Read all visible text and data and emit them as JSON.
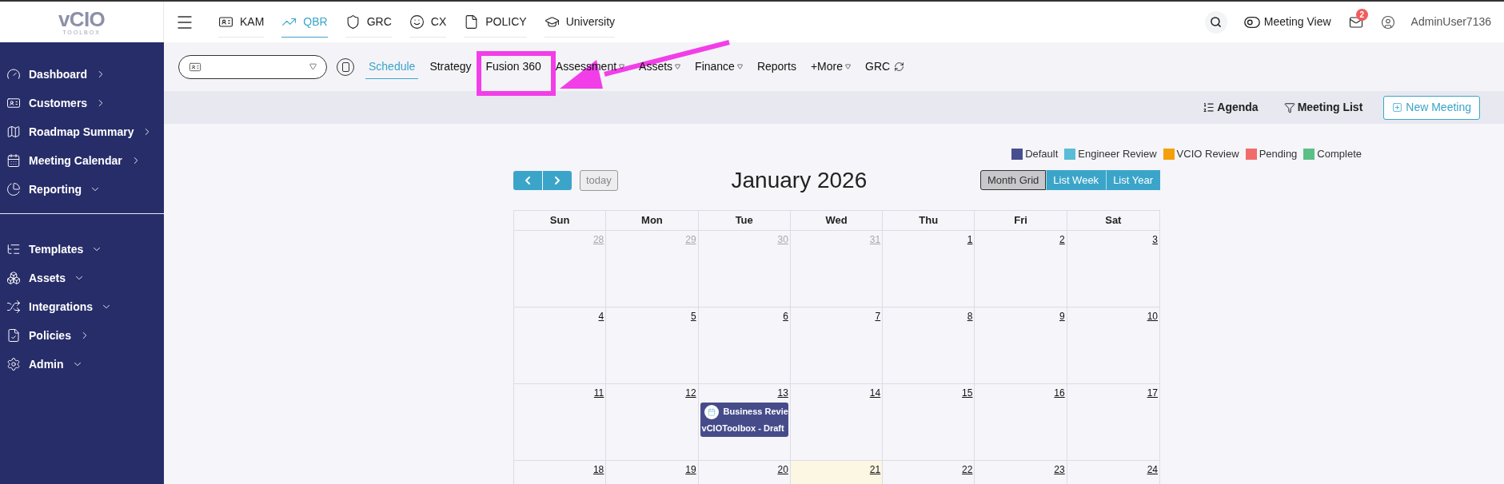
{
  "logo": {
    "text": "vCIO",
    "subtext": "TOOLBOX"
  },
  "sidebar": {
    "groups": [
      [
        {
          "label": "Dashboard",
          "expanded": false
        },
        {
          "label": "Customers",
          "expanded": false
        },
        {
          "label": "Roadmap Summary",
          "expanded": false
        },
        {
          "label": "Meeting Calendar",
          "expanded": false
        },
        {
          "label": "Reporting",
          "expanded": true
        }
      ],
      [
        {
          "label": "Templates",
          "expanded": true
        },
        {
          "label": "Assets",
          "expanded": true
        },
        {
          "label": "Integrations",
          "expanded": true
        },
        {
          "label": "Policies",
          "expanded": false
        },
        {
          "label": "Admin",
          "expanded": true
        }
      ]
    ]
  },
  "top_tabs": [
    {
      "label": "KAM",
      "selected": false
    },
    {
      "label": "QBR",
      "selected": true
    },
    {
      "label": "GRC",
      "selected": false
    },
    {
      "label": "CX",
      "selected": false
    },
    {
      "label": "POLICY",
      "selected": false
    },
    {
      "label": "University",
      "selected": false
    }
  ],
  "header": {
    "meeting_view": {
      "label": "Meeting View",
      "on": false
    },
    "mail_count": "2",
    "user": "AdminUser7136"
  },
  "subnav": [
    {
      "label": "Schedule",
      "selected": true,
      "kind": "plain"
    },
    {
      "label": "Strategy",
      "selected": false,
      "kind": "plain"
    },
    {
      "label": "Fusion 360",
      "selected": false,
      "kind": "plain"
    },
    {
      "label": "Assessment",
      "selected": false,
      "kind": "dropdown"
    },
    {
      "label": "Assets",
      "selected": false,
      "kind": "dropdown"
    },
    {
      "label": "Finance",
      "selected": false,
      "kind": "dropdown"
    },
    {
      "label": "Reports",
      "selected": false,
      "kind": "plain"
    },
    {
      "label": "+More",
      "selected": false,
      "kind": "dropdown"
    },
    {
      "label": "GRC",
      "selected": false,
      "kind": "refresh"
    }
  ],
  "toolbar": {
    "agenda": "Agenda",
    "meeting_list": "Meeting List",
    "new_meeting": "New Meeting"
  },
  "legend": [
    {
      "label": "Default",
      "color": "#474f8f"
    },
    {
      "label": "Engineer Review",
      "color": "#5bbcd6"
    },
    {
      "label": "VCIO Review",
      "color": "#f59f0a"
    },
    {
      "label": "Pending",
      "color": "#f26b6b"
    },
    {
      "label": "Complete",
      "color": "#5cbf86"
    }
  ],
  "calendar": {
    "title": "January 2026",
    "today": "today",
    "views": [
      {
        "label": "Month Grid",
        "selected": true
      },
      {
        "label": "List Week",
        "selected": false
      },
      {
        "label": "List Year",
        "selected": false
      }
    ],
    "weekdays": [
      "Sun",
      "Mon",
      "Tue",
      "Wed",
      "Thu",
      "Fri",
      "Sat"
    ],
    "weeks": [
      [
        {
          "day": "28",
          "other_month": true,
          "today": false
        },
        {
          "day": "29",
          "other_month": true,
          "today": false
        },
        {
          "day": "30",
          "other_month": true,
          "today": false
        },
        {
          "day": "31",
          "other_month": true,
          "today": false
        },
        {
          "day": "1",
          "other_month": false,
          "today": false
        },
        {
          "day": "2",
          "other_month": false,
          "today": false
        },
        {
          "day": "3",
          "other_month": false,
          "today": false
        }
      ],
      [
        {
          "day": "4",
          "other_month": false,
          "today": false
        },
        {
          "day": "5",
          "other_month": false,
          "today": false
        },
        {
          "day": "6",
          "other_month": false,
          "today": false
        },
        {
          "day": "7",
          "other_month": false,
          "today": false
        },
        {
          "day": "8",
          "other_month": false,
          "today": false
        },
        {
          "day": "9",
          "other_month": false,
          "today": false
        },
        {
          "day": "10",
          "other_month": false,
          "today": false
        }
      ],
      [
        {
          "day": "11",
          "other_month": false,
          "today": false
        },
        {
          "day": "12",
          "other_month": false,
          "today": false
        },
        {
          "day": "13",
          "other_month": false,
          "today": false,
          "events": [
            {
              "title": "Business Revie",
              "subtitle": "vCIOToolbox - Draft",
              "color": "#464c8a"
            }
          ]
        },
        {
          "day": "14",
          "other_month": false,
          "today": false
        },
        {
          "day": "15",
          "other_month": false,
          "today": false
        },
        {
          "day": "16",
          "other_month": false,
          "today": false
        },
        {
          "day": "17",
          "other_month": false,
          "today": false
        }
      ],
      [
        {
          "day": "18",
          "other_month": false,
          "today": false
        },
        {
          "day": "19",
          "other_month": false,
          "today": false
        },
        {
          "day": "20",
          "other_month": false,
          "today": false
        },
        {
          "day": "21",
          "other_month": false,
          "today": true
        },
        {
          "day": "22",
          "other_month": false,
          "today": false
        },
        {
          "day": "23",
          "other_month": false,
          "today": false
        },
        {
          "day": "24",
          "other_month": false,
          "today": false
        }
      ]
    ]
  }
}
